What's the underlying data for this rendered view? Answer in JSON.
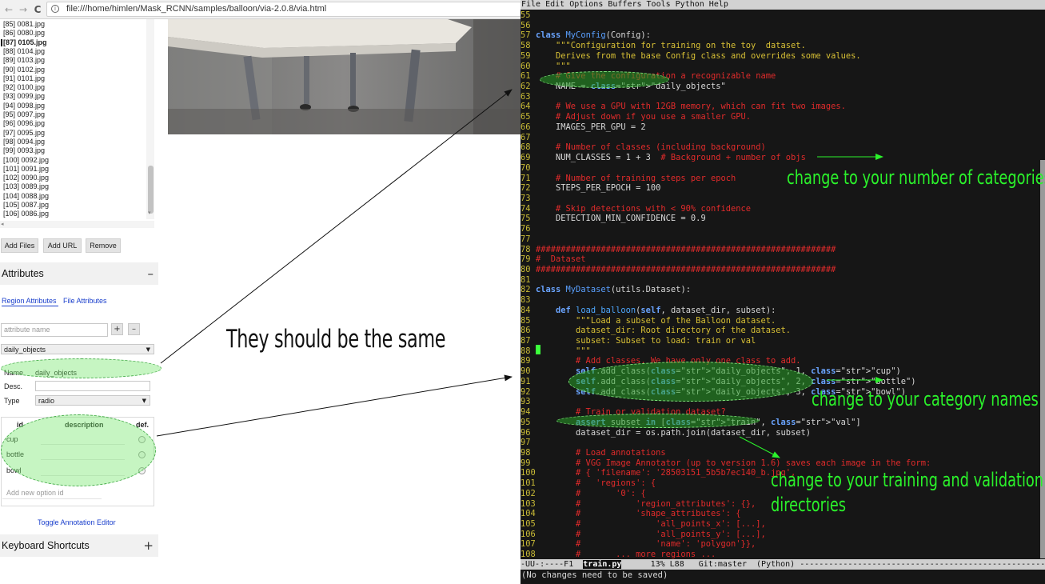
{
  "browser": {
    "url": "file:///home/himlen/Mask_RCNN/samples/balloon/via-2.0.8/via.html",
    "nav_back": "←",
    "nav_forward": "→",
    "nav_reload": "C",
    "info_icon": "i"
  },
  "file_list": [
    "[85] 0081.jpg",
    "[86] 0080.jpg",
    "[87] 0105.jpg",
    "[88] 0104.jpg",
    "[89] 0103.jpg",
    "[90] 0102.jpg",
    "[91] 0101.jpg",
    "[92] 0100.jpg",
    "[93] 0099.jpg",
    "[94] 0098.jpg",
    "[95] 0097.jpg",
    "[96] 0096.jpg",
    "[97] 0095.jpg",
    "[98] 0094.jpg",
    "[99] 0093.jpg",
    "[100] 0092.jpg",
    "[101] 0091.jpg",
    "[102] 0090.jpg",
    "[103] 0089.jpg",
    "[104] 0088.jpg",
    "[105] 0087.jpg",
    "[106] 0086.jpg"
  ],
  "file_buttons": {
    "add_files": "Add Files",
    "add_url": "Add URL",
    "remove": "Remove"
  },
  "attributes": {
    "header": "Attributes",
    "collapse": "–",
    "tab_region": "Region Attributes",
    "tab_file": "File Attributes",
    "attribute_name_placeholder": "attribute name",
    "add_btn": "+",
    "remove_btn": "–",
    "selected_attribute": "daily_objects",
    "name_label": "Name",
    "name_value": "daily_objects",
    "desc_label": "Desc.",
    "type_label": "Type",
    "type_value": "radio",
    "col_id": "id",
    "col_description": "description",
    "col_def": "def.",
    "options": [
      "cup",
      "bottle",
      "bowl"
    ],
    "new_option_placeholder": "Add new option id",
    "toggle_editor": "Toggle Annotation Editor"
  },
  "keyboard_shortcuts": {
    "header": "Keyboard Shortcuts",
    "expand": "+"
  },
  "annotation_left": "They should be the same",
  "emacs": {
    "menubar": "File Edit Options Buffers Tools Python Help",
    "lines": [
      {
        "n": "55",
        "t": ""
      },
      {
        "n": "56",
        "t": ""
      },
      {
        "n": "57",
        "t": "class MyConfig(Config):"
      },
      {
        "n": "58",
        "t": "    \"\"\"Configuration for training on the toy  dataset."
      },
      {
        "n": "59",
        "t": "    Derives from the base Config class and overrides some values."
      },
      {
        "n": "60",
        "t": "    \"\"\""
      },
      {
        "n": "61",
        "t": "    # Give the configuration a recognizable name"
      },
      {
        "n": "62",
        "t": "    NAME = \"daily_objects\""
      },
      {
        "n": "63",
        "t": ""
      },
      {
        "n": "64",
        "t": "    # We use a GPU with 12GB memory, which can fit two images."
      },
      {
        "n": "65",
        "t": "    # Adjust down if you use a smaller GPU."
      },
      {
        "n": "66",
        "t": "    IMAGES_PER_GPU = 2"
      },
      {
        "n": "67",
        "t": ""
      },
      {
        "n": "68",
        "t": "    # Number of classes (including background)"
      },
      {
        "n": "69",
        "t": "    NUM_CLASSES = 1 + 3  # Background + number of objs"
      },
      {
        "n": "70",
        "t": ""
      },
      {
        "n": "71",
        "t": "    # Number of training steps per epoch"
      },
      {
        "n": "72",
        "t": "    STEPS_PER_EPOCH = 100"
      },
      {
        "n": "73",
        "t": ""
      },
      {
        "n": "74",
        "t": "    # Skip detections with < 90% confidence"
      },
      {
        "n": "75",
        "t": "    DETECTION_MIN_CONFIDENCE = 0.9"
      },
      {
        "n": "76",
        "t": ""
      },
      {
        "n": "77",
        "t": ""
      },
      {
        "n": "78",
        "t": "############################################################"
      },
      {
        "n": "79",
        "t": "#  Dataset"
      },
      {
        "n": "80",
        "t": "############################################################"
      },
      {
        "n": "81",
        "t": ""
      },
      {
        "n": "82",
        "t": "class MyDataset(utils.Dataset):"
      },
      {
        "n": "83",
        "t": ""
      },
      {
        "n": "84",
        "t": "    def load_balloon(self, dataset_dir, subset):"
      },
      {
        "n": "85",
        "t": "        \"\"\"Load a subset of the Balloon dataset."
      },
      {
        "n": "86",
        "t": "        dataset_dir: Root directory of the dataset."
      },
      {
        "n": "87",
        "t": "        subset: Subset to load: train or val"
      },
      {
        "n": "88",
        "t": "        \"\"\""
      },
      {
        "n": "89",
        "t": "        # Add classes. We have only one class to add."
      },
      {
        "n": "90",
        "t": "        self.add_class(\"daily_objects\", 1, \"cup\")"
      },
      {
        "n": "91",
        "t": "        self.add_class(\"daily_objects\", 2, \"bottle\")"
      },
      {
        "n": "92",
        "t": "        self.add_class(\"daily_objects\", 3, \"bowl\")"
      },
      {
        "n": "93",
        "t": ""
      },
      {
        "n": "94",
        "t": "        # Train or validation dataset?"
      },
      {
        "n": "95",
        "t": "        assert subset in [\"train\", \"val\"]"
      },
      {
        "n": "96",
        "t": "        dataset_dir = os.path.join(dataset_dir, subset)"
      },
      {
        "n": "97",
        "t": ""
      },
      {
        "n": "98",
        "t": "        # Load annotations"
      },
      {
        "n": "99",
        "t": "        # VGG Image Annotator (up to version 1.6) saves each image in the form:"
      },
      {
        "n": "100",
        "t": "        # { 'filename': '28503151_5b5b7ec140_b.jpg',"
      },
      {
        "n": "101",
        "t": "        #   'regions': {"
      },
      {
        "n": "102",
        "t": "        #       '0': {"
      },
      {
        "n": "103",
        "t": "        #           'region_attributes': {},"
      },
      {
        "n": "104",
        "t": "        #           'shape_attributes': {"
      },
      {
        "n": "105",
        "t": "        #               'all_points_x': [...],"
      },
      {
        "n": "106",
        "t": "        #               'all_points_y': [...],"
      },
      {
        "n": "107",
        "t": "        #               'name': 'polygon'}},"
      },
      {
        "n": "108",
        "t": "        #       ... more regions ..."
      }
    ],
    "modeline_left": "-UU-:----F1  ",
    "modeline_buffer": "train.py",
    "modeline_right": "      13% L88   Git:master  (Python) -----------------------------------------------------",
    "minibuffer": "(No changes need to be saved)"
  },
  "callouts": {
    "categories": "change to your number of categories",
    "names": "change to your category names",
    "dirs_line1": "change to your training and validation",
    "dirs_line2": "directories"
  },
  "colors": {
    "callout_green": "#2bf22b",
    "comment_red": "#e12b2b",
    "string_yellow": "#d8c035",
    "keyword_blue": "#6aa4ff",
    "link_blue": "#1a3fcc"
  }
}
